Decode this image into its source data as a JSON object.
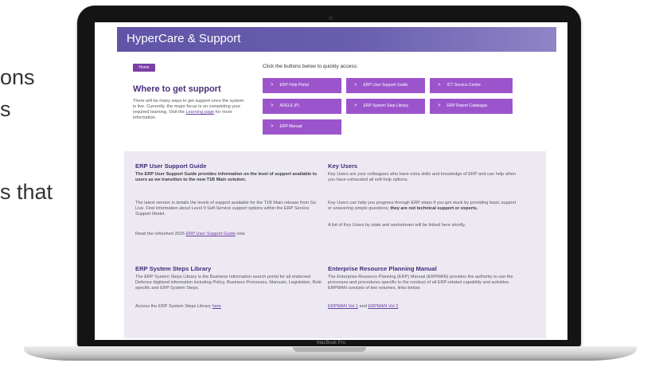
{
  "background_text": {
    "line1": "ons",
    "line2": "s",
    "line3": "s that"
  },
  "device": {
    "brand_label": "MacBook Pro"
  },
  "page": {
    "banner_title": "HyperCare & Support",
    "home_button": "Home",
    "intro": "Click the buttons below to quickly access:",
    "where": {
      "title": "Where to get support",
      "text_before_link": "There will be many ways to get support once the system is live. Currently, the major focus is on completing your required learning. Visit the ",
      "link": "Learning page",
      "text_after_link": " for more information."
    },
    "quick_buttons": [
      "ERP Help Portal",
      "ERP User Support Guide",
      "ICT Service Centre",
      "ADELE (P)",
      "ERP System Step Library",
      "ERP Report Catalogue",
      "ERP Manual"
    ],
    "chevron": ">",
    "user_guide": {
      "title": "ERP User Support Guide",
      "lead": "The ERP User Support Guide provides information on the level of support available to users as we transition to the new T1B Main solution.",
      "para2": "The latest version is details the levels of support available for the T1B Main release from Go Live. Find information about Level 0 Self-Service support options within the ERP Service Support Model.",
      "read_prefix": "Read the refreshed 2025 ",
      "read_link": "ERP User Support Guide",
      "read_suffix": " now"
    },
    "key_users": {
      "title": "Key Users",
      "lead": "Key Users are your colleagues who have extra skills and knowledge of ERP and can help when you have exhausted all self-help options.",
      "para2": "Key Users can help you progress through ERP steps if you get stuck by providing basic support or answering simple questions; ",
      "para2_bold": "they are not technical support or experts.",
      "para3": "A list of Key Users by state and workstream will be linked here shortly."
    },
    "steps_library": {
      "title": "ERP System Steps Library",
      "body": "The ERP System Steps Library is the Business Information search portal for all endorsed Defence digitised information including Policy, Business Processes, Manuals, Legislation, Role specific and ERP System Steps.",
      "access_prefix": "Access the ERP System Steps Library ",
      "access_link": "here"
    },
    "manual": {
      "title": "Enterprise Resource Planning Manual",
      "body": "The Enterprise Resource Planning (ERP) Manual (ERPMAN) provides the authority to use the processes and procedures specific to the conduct of all ERP-related capability and activities. ERPMAN consists of two volumes, links below:",
      "vol1": "ERPMAN Vol 1",
      "and": " and ",
      "vol2": "ERPMAN Vol 2"
    }
  }
}
